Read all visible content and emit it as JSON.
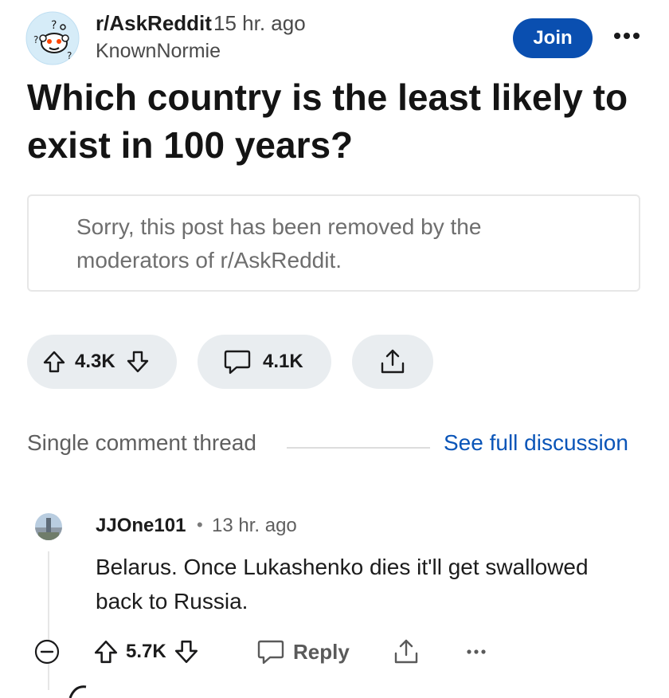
{
  "post": {
    "subreddit": "r/AskReddit",
    "time": "15 hr. ago",
    "author": "KnownNormie",
    "join_label": "Join",
    "title": "Which country is the least likely to exist in 100 years?",
    "removed_notice": "Sorry, this post has been removed by the moderators of r/AskReddit.",
    "upvotes": "4.3K",
    "comments": "4.1K"
  },
  "thread": {
    "label": "Single comment thread",
    "link": "See full discussion"
  },
  "comment": {
    "user": "JJOne101",
    "separator": "•",
    "time": "13 hr. ago",
    "body": "Belarus. Once Lukashenko dies it'll get swallowed back to Russia.",
    "score": "5.7K",
    "reply_label": "Reply"
  },
  "colors": {
    "join": "#0a4fb0",
    "link": "#0a55b8",
    "pill": "#e9edf0",
    "avatar_bg": "#d6ecf8"
  },
  "icons": [
    "subreddit-avatar",
    "more-icon",
    "upvote-icon",
    "downvote-icon",
    "comment-icon",
    "share-icon",
    "collapse-icon",
    "reply-icon"
  ]
}
